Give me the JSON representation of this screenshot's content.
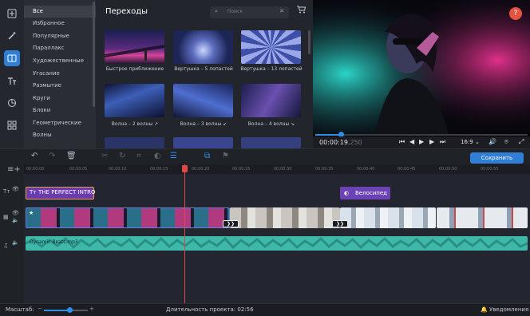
{
  "rail": {
    "icons": [
      "import-icon",
      "magic-wand-icon",
      "transitions-icon",
      "titles-icon",
      "stickers-icon",
      "more-tools-icon"
    ]
  },
  "categories": [
    "Все",
    "Избранное",
    "Популярные",
    "Параллакс",
    "Художественные",
    "Угасание",
    "Размытие",
    "Круги",
    "Блоки",
    "Геометрические",
    "Волны"
  ],
  "panel": {
    "title": "Переходы",
    "search_placeholder": "Поиск",
    "items": [
      {
        "label": "Быстрое приближение"
      },
      {
        "label": "Вертушка – 5 лопастей"
      },
      {
        "label": "Вертушка – 13 лопастей"
      },
      {
        "label": "Волна – 2 волны ↗"
      },
      {
        "label": "Волна – 3 волны ↙"
      },
      {
        "label": "Волна – 4 волны ↘"
      }
    ]
  },
  "player": {
    "time": "00:00:19.",
    "time_ms": "250",
    "ratio": "16:9",
    "help": "?",
    "progress": 0.12
  },
  "toolbar": {
    "save_label": "Сохранить"
  },
  "ruler": [
    "00:00:00",
    "00:00:05",
    "00:00:10",
    "00:00:15",
    "00:00:20",
    "00:00:25",
    "00:00:30",
    "00:00:35",
    "00:00:40",
    "00:00:45",
    "00:00:50",
    "00:00:55"
  ],
  "timeline": {
    "title_clip": "THE PERFECT INTRO",
    "sticker_clip": "Велосипед",
    "audio_clip": "Dynamic Beats.mp3"
  },
  "status": {
    "scale_label": "Масштаб:",
    "duration": "Длительность проекта:  02:56",
    "notifications": "Уведомления",
    "zoom": 0.55
  },
  "colors": {
    "accent": "#2f7fd6",
    "playhead": "#e04848",
    "title_clip": "#6a3bb0",
    "audio": "#3eb8a8"
  }
}
